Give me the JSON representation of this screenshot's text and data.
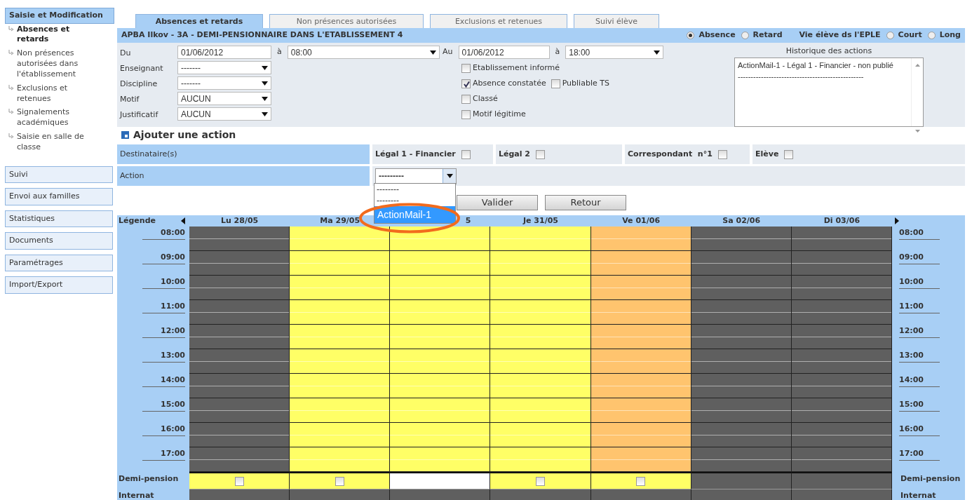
{
  "sidebar": {
    "header": {
      "label": "Saisie et Modification",
      "selected": true
    },
    "items": [
      {
        "label": "Absences et retards",
        "selected": true
      },
      {
        "label": "Non présences autorisées dans l'établissement",
        "selected": false
      },
      {
        "label": "Exclusions et retenues",
        "selected": false
      },
      {
        "label": "Signalements académiques",
        "selected": false
      },
      {
        "label": "Saisie en salle de classe",
        "selected": false
      }
    ],
    "sections": [
      "Suivi",
      "Envoi aux familles",
      "Statistiques",
      "Documents",
      "Paramétrages",
      "Import/Export"
    ]
  },
  "tabs": [
    {
      "label": "Absences et retards",
      "selected": true
    },
    {
      "label": "Non présences autorisées",
      "selected": false
    },
    {
      "label": "Exclusions et retenues",
      "selected": false
    },
    {
      "label": "Suivi élève",
      "selected": false
    }
  ],
  "title_bar": {
    "student": "APBA Ilkov - 3A - DEMI-PENSIONNAIRE DANS L'ETABLISSEMENT 4",
    "type_radios": [
      {
        "label": "Absence",
        "selected": true
      },
      {
        "label": "Retard",
        "selected": false
      }
    ],
    "vie_label": "Vie élève ds l'EPLE",
    "duration_radios": [
      {
        "label": "Court",
        "selected": false
      },
      {
        "label": "Long",
        "selected": false
      }
    ]
  },
  "form": {
    "fields": [
      {
        "label": "Du",
        "value": "01/06/2012",
        "kind": "text",
        "time_label": "à",
        "time": "08:00"
      },
      {
        "label": "Enseignant",
        "value": "-------",
        "kind": "select"
      },
      {
        "label": "Discipline",
        "value": "-------",
        "kind": "select"
      },
      {
        "label": "Motif",
        "value": "AUCUN",
        "kind": "select"
      },
      {
        "label": "Justificatif",
        "value": "AUCUN",
        "kind": "select"
      }
    ],
    "au": {
      "label": "Au",
      "value": "01/06/2012",
      "time_label": "à",
      "time": "18:00"
    },
    "checkboxes": [
      [
        {
          "label": "Etablissement informé",
          "checked": false
        }
      ],
      [
        {
          "label": "Absence constatée",
          "checked": true
        },
        {
          "label": "Publiable TS",
          "checked": false
        }
      ],
      [
        {
          "label": "Classé",
          "checked": false
        }
      ],
      [
        {
          "label": "Motif légitime",
          "checked": false
        }
      ]
    ],
    "history": {
      "title": "Historique des actions",
      "lines": [
        "ActionMail-1 - Légal 1 - Financier - non publié",
        "-------------------------------------------------"
      ]
    }
  },
  "add_action": {
    "title": "Ajouter une action",
    "recipients_label": "Destinataire(s)",
    "recipients": [
      {
        "label": "Légal 1 - Financier",
        "checked": false
      },
      {
        "label": "Légal 2",
        "checked": false
      },
      {
        "label": "Correspondant  n°1",
        "checked": false
      },
      {
        "label": "Elève",
        "checked": false
      }
    ],
    "action_label": "Action",
    "action_value": "---------",
    "action_options": [
      {
        "label": "--------",
        "selected": false
      },
      {
        "label": "--------",
        "selected": false
      },
      {
        "label": "ActionMail-1",
        "selected": true
      }
    ],
    "buttons": [
      "Valider",
      "Retour"
    ]
  },
  "calendar": {
    "legend": "Légende",
    "days": [
      {
        "label": "Lu 28/05",
        "color": "#5f5f5f"
      },
      {
        "label": "Ma 29/05",
        "color": "#ffff66"
      },
      {
        "label": "5",
        "color": "#ffff66"
      },
      {
        "label": "Je 31/05",
        "color": "#ffff66"
      },
      {
        "label": "Ve 01/06",
        "color": "#ffc46e"
      },
      {
        "label": "Sa 02/06",
        "color": "#5f5f5f"
      },
      {
        "label": "Di 03/06",
        "color": "#5f5f5f"
      }
    ],
    "hours": [
      "08:00",
      "09:00",
      "10:00",
      "11:00",
      "12:00",
      "13:00",
      "14:00",
      "15:00",
      "16:00",
      "17:00"
    ],
    "hours_right": [
      "08:00",
      "09:00",
      "10:00",
      "11:00",
      "12:00",
      "13:00",
      "14:00",
      "15:00",
      "16:00",
      "17:00"
    ],
    "rows": [
      {
        "label": "Demi-pension",
        "label_right": "Demi-pension",
        "cells": [
          {
            "color": "#ffff66",
            "checkbox": true,
            "checked": false
          },
          {
            "color": "#ffff66",
            "checkbox": true,
            "checked": false
          },
          {
            "color": "#ffffff",
            "checkbox": false
          },
          {
            "color": "#ffff66",
            "checkbox": true,
            "checked": false
          },
          {
            "color": "#ffff66",
            "checkbox": true,
            "checked": false
          },
          {
            "color": "#5f5f5f",
            "checkbox": false
          },
          {
            "color": "#5f5f5f",
            "checkbox": false
          }
        ]
      },
      {
        "label": "Internat",
        "label_right": "Internat",
        "cells": [
          {
            "color": "#5f5f5f",
            "checkbox": false
          },
          {
            "color": "#5f5f5f",
            "checkbox": false
          },
          {
            "color": "#5f5f5f",
            "checkbox": false
          },
          {
            "color": "#5f5f5f",
            "checkbox": false
          },
          {
            "color": "#5f5f5f",
            "checkbox": false
          },
          {
            "color": "#5f5f5f",
            "checkbox": false
          },
          {
            "color": "#5f5f5f",
            "checkbox": false
          }
        ]
      }
    ]
  }
}
